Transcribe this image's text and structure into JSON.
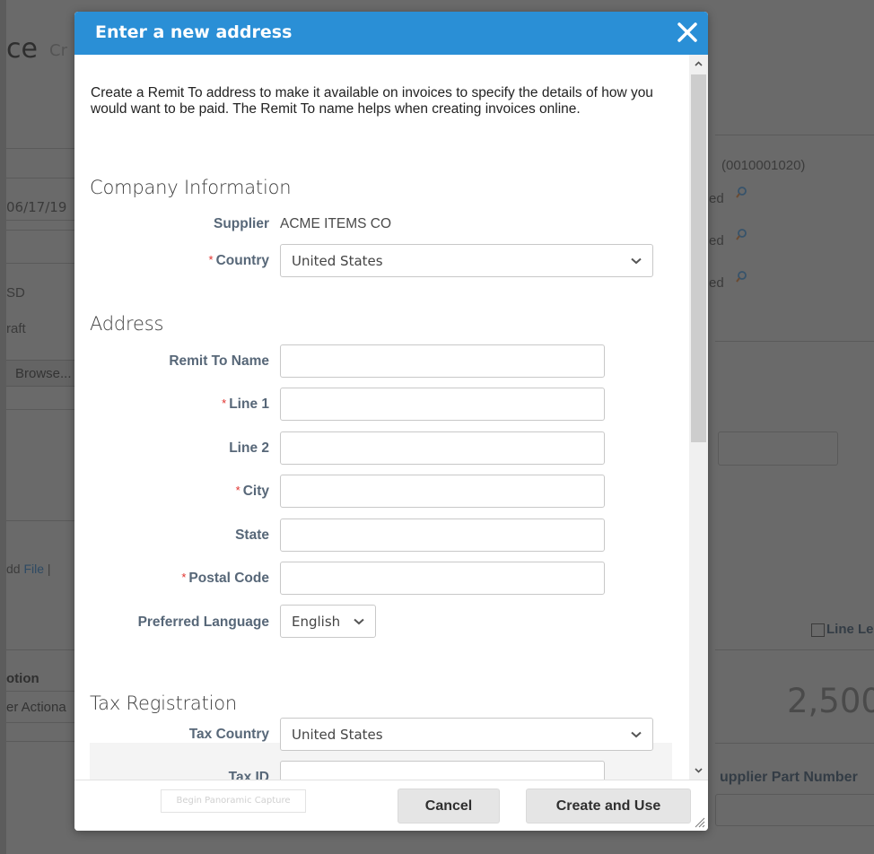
{
  "background_page": {
    "title_fragment": "ce",
    "title_sub_fragment": "Cr",
    "date_fragment": "06/17/19",
    "currency_fragment": "SD",
    "status_fragment": "raft",
    "browse_button": "Browse...",
    "add_file_prefix": "dd",
    "add_file_link": "File",
    "add_file_sep": "|",
    "column_header_fragment": "otion",
    "row_value_fragment": "er Actiona",
    "account_code": "(0010001020)",
    "ed_fragments": [
      "ed",
      "ed",
      "ed"
    ],
    "line_level_label": "Line Le",
    "amount": "2,500.",
    "supplier_part_number_label": "upplier Part Number"
  },
  "modal": {
    "title": "Enter a new address",
    "intro": "Create a Remit To address to make it available on invoices to specify the details of how you would want to be paid. The Remit To name helps when creating invoices online.",
    "sections": {
      "company": "Company Information",
      "address": "Address",
      "tax": "Tax Registration"
    },
    "fields": {
      "supplier": {
        "label": "Supplier",
        "value": "ACME ITEMS CO"
      },
      "country": {
        "label": "Country",
        "required": "*",
        "value": "United States"
      },
      "remit_to_name": {
        "label": "Remit To Name",
        "value": ""
      },
      "line1": {
        "label": "Line 1",
        "required": "*",
        "value": ""
      },
      "line2": {
        "label": "Line 2",
        "value": ""
      },
      "city": {
        "label": "City",
        "required": "*",
        "value": ""
      },
      "state": {
        "label": "State",
        "value": ""
      },
      "postal_code": {
        "label": "Postal Code",
        "required": "*",
        "value": ""
      },
      "preferred_language": {
        "label": "Preferred Language",
        "value": "English"
      },
      "tax_country": {
        "label": "Tax Country",
        "value": "United States"
      },
      "tax_id": {
        "label": "Tax ID",
        "value": ""
      }
    },
    "footer": {
      "panoramic_capture": "Begin Panoramic Capture",
      "cancel": "Cancel",
      "create_and_use": "Create and Use"
    }
  },
  "colors": {
    "header_blue": "#2a8fd6",
    "label_slate": "#576778",
    "required_red": "#e0302c"
  }
}
